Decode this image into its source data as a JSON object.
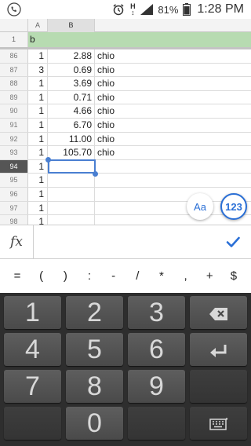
{
  "status_bar": {
    "network": "H",
    "battery_percent": "81%",
    "time": "1:28 PM"
  },
  "sheet": {
    "corner_label": "1",
    "columns": [
      "A",
      "B"
    ],
    "frozen_row": {
      "row_num": "1",
      "a": "b"
    },
    "rows": [
      {
        "row_num": "86",
        "a": "1",
        "b": "2.88",
        "c": "chio"
      },
      {
        "row_num": "87",
        "a": "3",
        "b": "0.69",
        "c": "chio"
      },
      {
        "row_num": "88",
        "a": "1",
        "b": "3.69",
        "c": "chio"
      },
      {
        "row_num": "89",
        "a": "1",
        "b": "0.71",
        "c": "chio"
      },
      {
        "row_num": "90",
        "a": "1",
        "b": "4.66",
        "c": "chio"
      },
      {
        "row_num": "91",
        "a": "1",
        "b": "6.70",
        "c": "chio"
      },
      {
        "row_num": "92",
        "a": "1",
        "b": "11.00",
        "c": "chio"
      },
      {
        "row_num": "93",
        "a": "1",
        "b": "105.70",
        "c": "chio"
      },
      {
        "row_num": "94",
        "a": "1",
        "b": "",
        "c": ""
      },
      {
        "row_num": "95",
        "a": "1",
        "b": "",
        "c": ""
      },
      {
        "row_num": "96",
        "a": "1",
        "b": "",
        "c": ""
      },
      {
        "row_num": "97",
        "a": "1",
        "b": "",
        "c": ""
      },
      {
        "row_num": "98",
        "a": "1",
        "b": "",
        "c": ""
      }
    ],
    "selected_row": "94",
    "selected_column": "B"
  },
  "buttons": {
    "text_format": "Aa",
    "number_keyboard": "123"
  },
  "formula_bar": {
    "fx_label": "fx",
    "value": ""
  },
  "symbols": [
    "=",
    "(",
    ")",
    ":",
    "-",
    "/",
    "*",
    ",",
    "+",
    "$"
  ],
  "keypad": {
    "keys": [
      "1",
      "2",
      "3",
      "4",
      "5",
      "6",
      "7",
      "8",
      "9",
      "0"
    ]
  },
  "colors": {
    "frozen_row": "#b7dbb1",
    "selection": "#4a7fd1",
    "accent": "#2a6fd6",
    "keypad_bg": "#2e2e2e"
  }
}
